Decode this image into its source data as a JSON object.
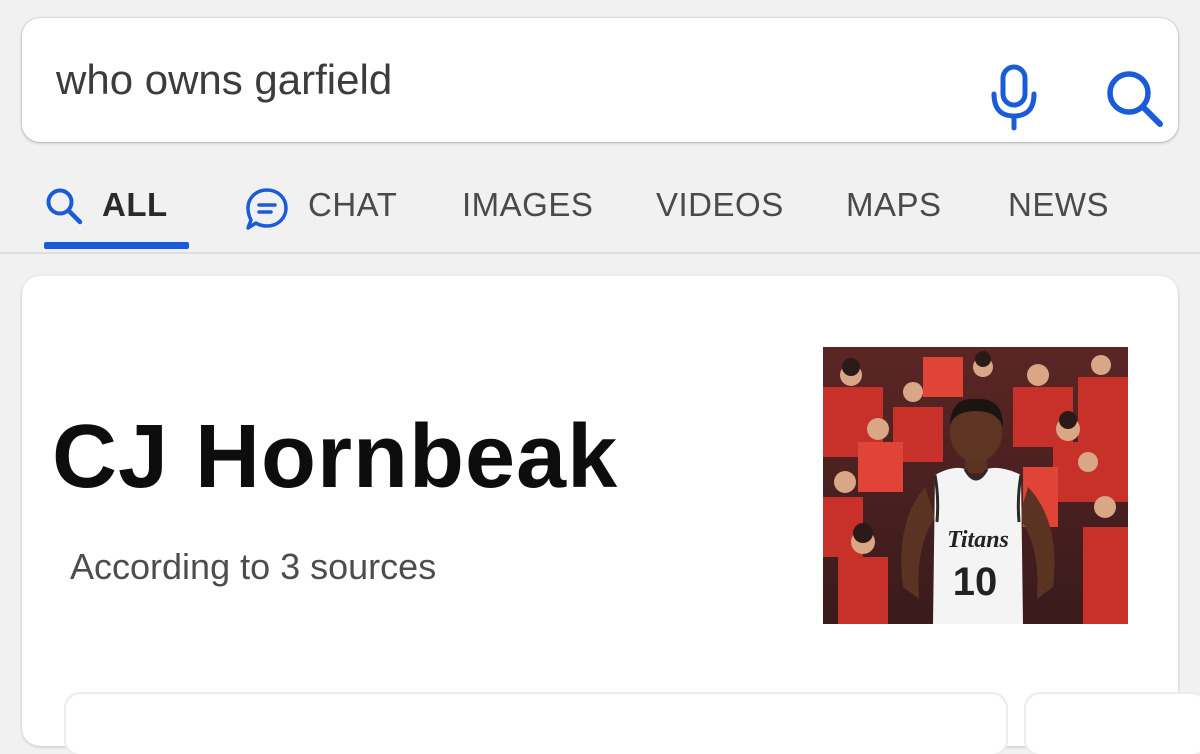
{
  "search": {
    "query": "who owns garfield",
    "mic_icon": "microphone-icon",
    "search_icon": "magnifier-icon",
    "accent_color": "#1a5cd8"
  },
  "tabs": [
    {
      "label": "ALL",
      "icon": "search-icon",
      "active": true
    },
    {
      "label": "CHAT",
      "icon": "chat-bubble-icon",
      "active": false
    },
    {
      "label": "IMAGES",
      "active": false
    },
    {
      "label": "VIDEOS",
      "active": false
    },
    {
      "label": "MAPS",
      "active": false
    },
    {
      "label": "NEWS",
      "active": false
    }
  ],
  "answer": {
    "title": "CJ Hornbeak",
    "sources_note": "According to 3 sources",
    "image": {
      "jersey_text": "Titans",
      "jersey_number": "10"
    }
  }
}
